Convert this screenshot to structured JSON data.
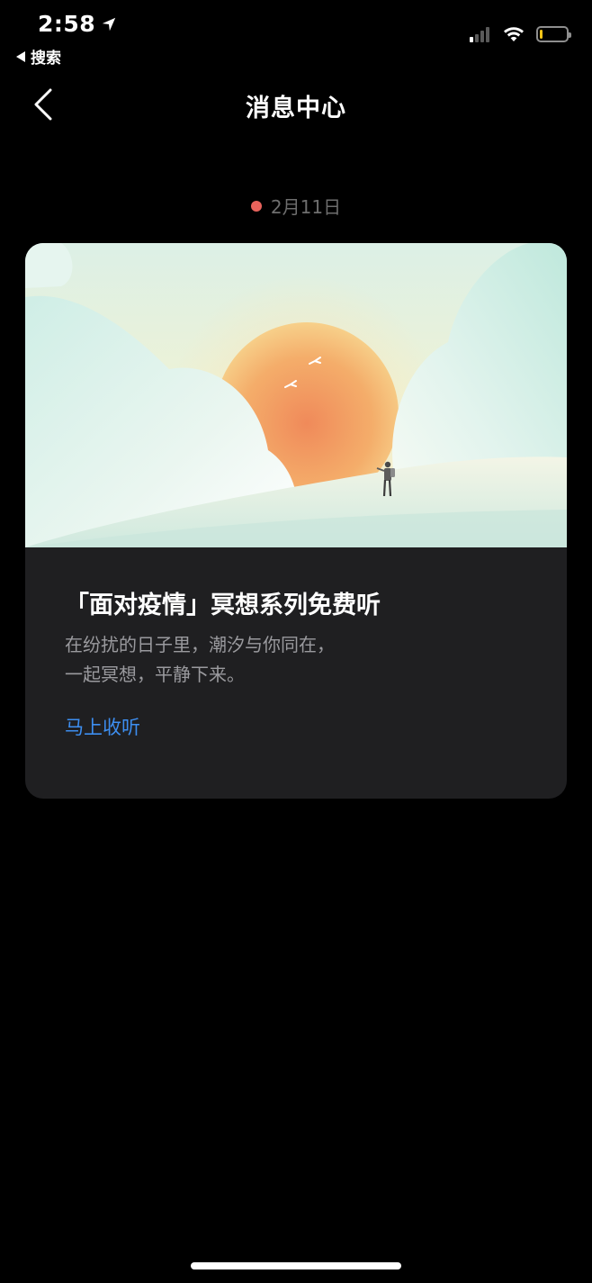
{
  "status_bar": {
    "time": "2:58",
    "back_app_label": "搜索",
    "signal_bars_active": 1,
    "signal_bars_total": 4,
    "battery_level": 0.1,
    "battery_color": "#f5c518",
    "icons": [
      "location-arrow-icon",
      "cellular-signal-icon",
      "wifi-icon",
      "battery-icon"
    ]
  },
  "nav": {
    "back_icon": "chevron-left-icon",
    "title": "消息中心"
  },
  "messages": [
    {
      "date": "2月11日",
      "unread_dot_color": "#e8635c",
      "image": "sunrise-meditation-illustration",
      "title": "「面对疫情」冥想系列免费听",
      "description_lines": [
        "在纷扰的日子里，潮汐与你同在，",
        "一起冥想，平静下来。"
      ],
      "action_label": "马上收听",
      "action_color": "#3d8ef0"
    }
  ]
}
